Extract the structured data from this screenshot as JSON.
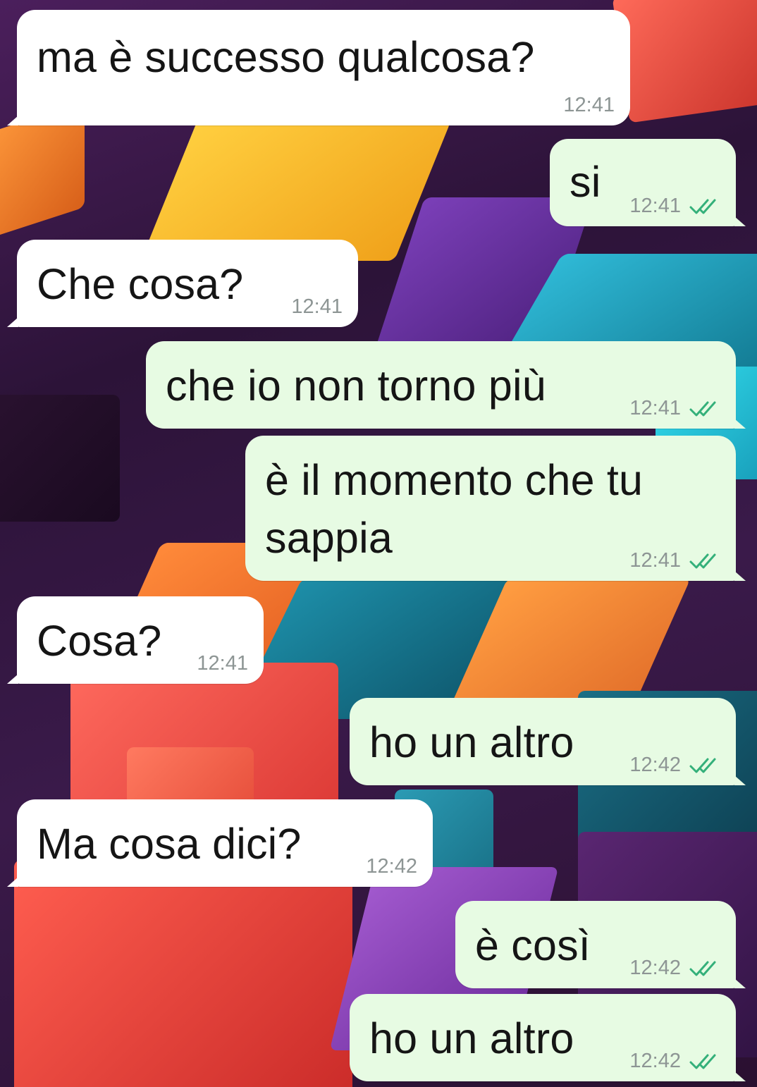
{
  "theme": {
    "incoming_bubble": "#ffffff",
    "outgoing_bubble": "#e7fbe3",
    "tick_color": "#34b07a",
    "time_color": "#8d9594"
  },
  "messages": [
    {
      "direction": "incoming",
      "text": "ma è successo qualcosa?",
      "time": "12:41"
    },
    {
      "direction": "outgoing",
      "text": "si",
      "time": "12:41",
      "status": "double-tick-icon"
    },
    {
      "direction": "incoming",
      "text": "Che cosa?",
      "time": "12:41"
    },
    {
      "direction": "outgoing",
      "text": "che io non torno più",
      "time": "12:41",
      "status": "double-tick-icon"
    },
    {
      "direction": "outgoing",
      "text": "è il momento che tu\nsappia",
      "time": "12:41",
      "status": "double-tick-icon"
    },
    {
      "direction": "incoming",
      "text": "Cosa?",
      "time": "12:41"
    },
    {
      "direction": "outgoing",
      "text": "ho un altro",
      "time": "12:42",
      "status": "double-tick-icon"
    },
    {
      "direction": "incoming",
      "text": "Ma cosa dici?",
      "time": "12:42"
    },
    {
      "direction": "outgoing",
      "text": "è così",
      "time": "12:42",
      "status": "double-tick-icon"
    },
    {
      "direction": "outgoing",
      "text": "ho un altro",
      "time": "12:42",
      "status": "double-tick-icon"
    }
  ]
}
